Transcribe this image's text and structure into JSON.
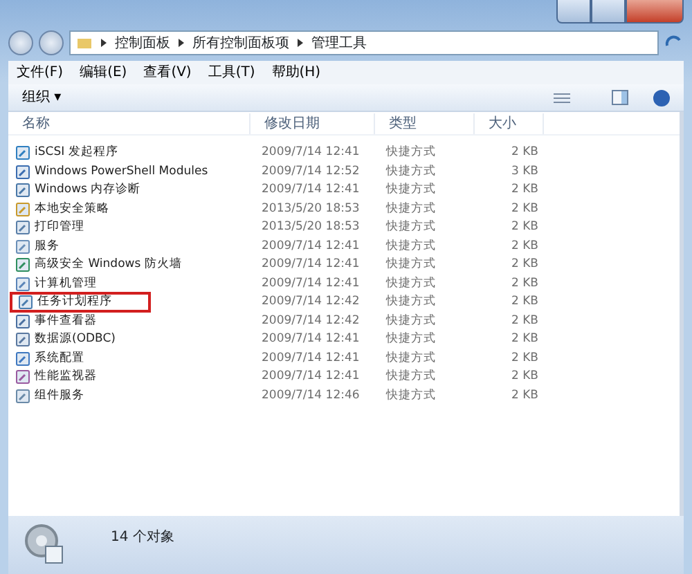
{
  "address": {
    "crumbs": [
      "控制面板",
      "所有控制面板项",
      "管理工具"
    ]
  },
  "menu": [
    "文件(F)",
    "编辑(E)",
    "查看(V)",
    "工具(T)",
    "帮助(H)"
  ],
  "toolbar": {
    "organize": "组织 ▾"
  },
  "table": {
    "columns": [
      "名称",
      "修改日期",
      "类型",
      "大小"
    ],
    "rows": [
      {
        "name": "iSCSI 发起程序",
        "date": "2009/7/14 12:41",
        "type": "快捷方式",
        "size": "2 KB",
        "highlighted": false
      },
      {
        "name": "Windows PowerShell Modules",
        "date": "2009/7/14 12:52",
        "type": "快捷方式",
        "size": "3 KB",
        "highlighted": false
      },
      {
        "name": "Windows 内存诊断",
        "date": "2009/7/14 12:41",
        "type": "快捷方式",
        "size": "2 KB",
        "highlighted": false
      },
      {
        "name": "本地安全策略",
        "date": "2013/5/20 18:53",
        "type": "快捷方式",
        "size": "2 KB",
        "highlighted": false
      },
      {
        "name": "打印管理",
        "date": "2013/5/20 18:53",
        "type": "快捷方式",
        "size": "2 KB",
        "highlighted": false
      },
      {
        "name": "服务",
        "date": "2009/7/14 12:41",
        "type": "快捷方式",
        "size": "2 KB",
        "highlighted": false
      },
      {
        "name": "高级安全 Windows 防火墙",
        "date": "2009/7/14 12:41",
        "type": "快捷方式",
        "size": "2 KB",
        "highlighted": false
      },
      {
        "name": "计算机管理",
        "date": "2009/7/14 12:41",
        "type": "快捷方式",
        "size": "2 KB",
        "highlighted": false
      },
      {
        "name": "任务计划程序",
        "date": "2009/7/14 12:42",
        "type": "快捷方式",
        "size": "2 KB",
        "highlighted": true
      },
      {
        "name": "事件查看器",
        "date": "2009/7/14 12:42",
        "type": "快捷方式",
        "size": "2 KB",
        "highlighted": false
      },
      {
        "name": "数据源(ODBC)",
        "date": "2009/7/14 12:41",
        "type": "快捷方式",
        "size": "2 KB",
        "highlighted": false
      },
      {
        "name": "系统配置",
        "date": "2009/7/14 12:41",
        "type": "快捷方式",
        "size": "2 KB",
        "highlighted": false
      },
      {
        "name": "性能监视器",
        "date": "2009/7/14 12:41",
        "type": "快捷方式",
        "size": "2 KB",
        "highlighted": false
      },
      {
        "name": "组件服务",
        "date": "2009/7/14 12:46",
        "type": "快捷方式",
        "size": "2 KB",
        "highlighted": false
      }
    ]
  },
  "status_bar": {
    "count": "14 个对象"
  }
}
